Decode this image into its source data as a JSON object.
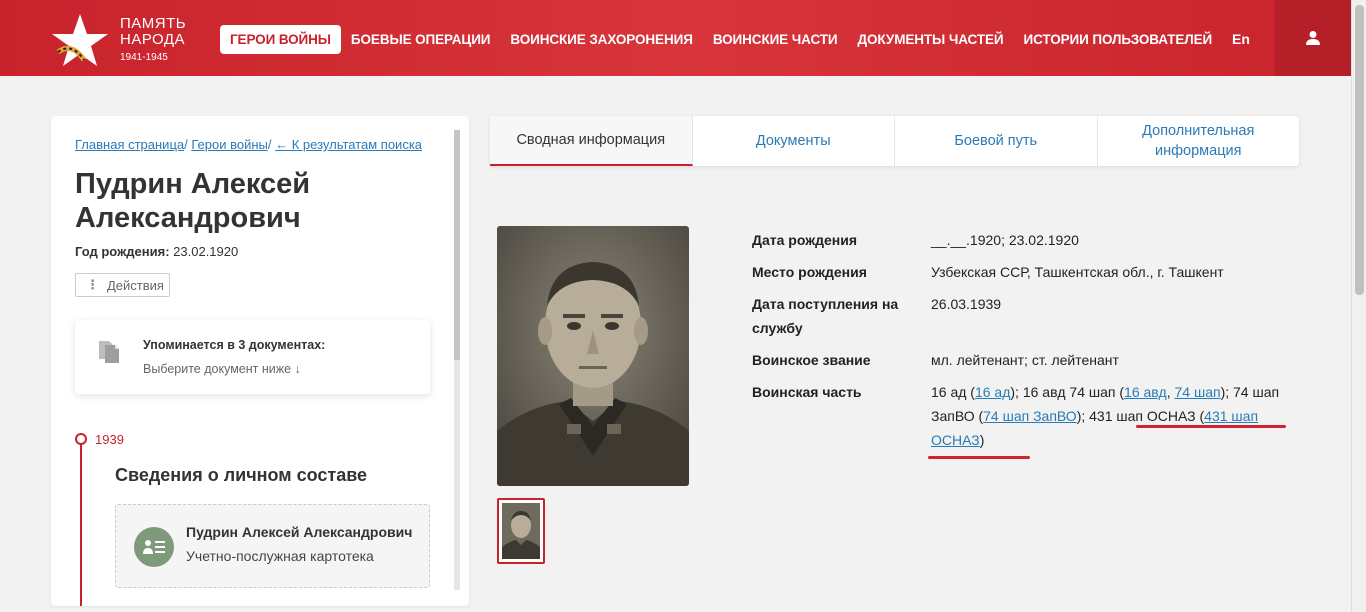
{
  "header": {
    "logo_line1": "ПАМЯТЬ",
    "logo_line2": "НАРОДА",
    "logo_years": "1941-1945",
    "nav": [
      {
        "label": "ГЕРОИ ВОЙНЫ",
        "active": true
      },
      {
        "label": "БОЕВЫЕ ОПЕРАЦИИ"
      },
      {
        "label": "ВОИНСКИЕ ЗАХОРОНЕНИЯ"
      },
      {
        "label": "ВОИНСКИЕ ЧАСТИ"
      },
      {
        "label": "ДОКУМЕНТЫ ЧАСТЕЙ"
      },
      {
        "label": "ИСТОРИИ ПОЛЬЗОВАТЕЛЕЙ"
      }
    ],
    "lang": "En",
    "user_icon": "user-icon"
  },
  "breadcrumb": {
    "home": "Главная страница",
    "heroes": "Герои войны",
    "back": "← К результатам поиска"
  },
  "person": {
    "name": "Пудрин Алексей Александрович",
    "birth_label": "Год рождения:",
    "birth_value": "23.02.1920",
    "actions_label": "Действия"
  },
  "mentions": {
    "title": "Упоминается в 3 документах:",
    "subtitle": "Выберите документ ниже ↓"
  },
  "timeline": {
    "year": "1939",
    "section_title": "Сведения о личном составе",
    "card_name": "Пудрин Алексей Александрович",
    "card_type": "Учетно-послужная картотека"
  },
  "tabs": [
    {
      "label": "Сводная информация",
      "active": true
    },
    {
      "label": "Документы"
    },
    {
      "label": "Боевой путь"
    },
    {
      "label": "Дополнительная информация"
    }
  ],
  "info": {
    "birth_date_label": "Дата рождения",
    "birth_date_value": "__.__.1920; 23.02.1920",
    "birth_place_label": "Место рождения",
    "birth_place_value": "Узбекская ССР, Ташкентская обл., г. Ташкент",
    "service_label": "Дата поступления на службу",
    "service_value": "26.03.1939",
    "rank_label": "Воинское звание",
    "rank_value": "мл. лейтенант; ст. лейтенант",
    "unit_label": "Воинская часть",
    "unit": {
      "t1": "16 ад (",
      "l1": "16 ад",
      "t2": "); 16 авд 74 шап (",
      "l2": "16 авд",
      "t3": ", ",
      "l3": "74 шап",
      "t4": "); 74 шап ЗапВО (",
      "l4": "74 шап ЗапВО",
      "t5": "); 431 шап ОСНАЗ (",
      "l5": "431 шап ОСНАЗ",
      "t6": ")"
    }
  },
  "colors": {
    "brand": "#c8232c",
    "link": "#2a7ab6"
  }
}
